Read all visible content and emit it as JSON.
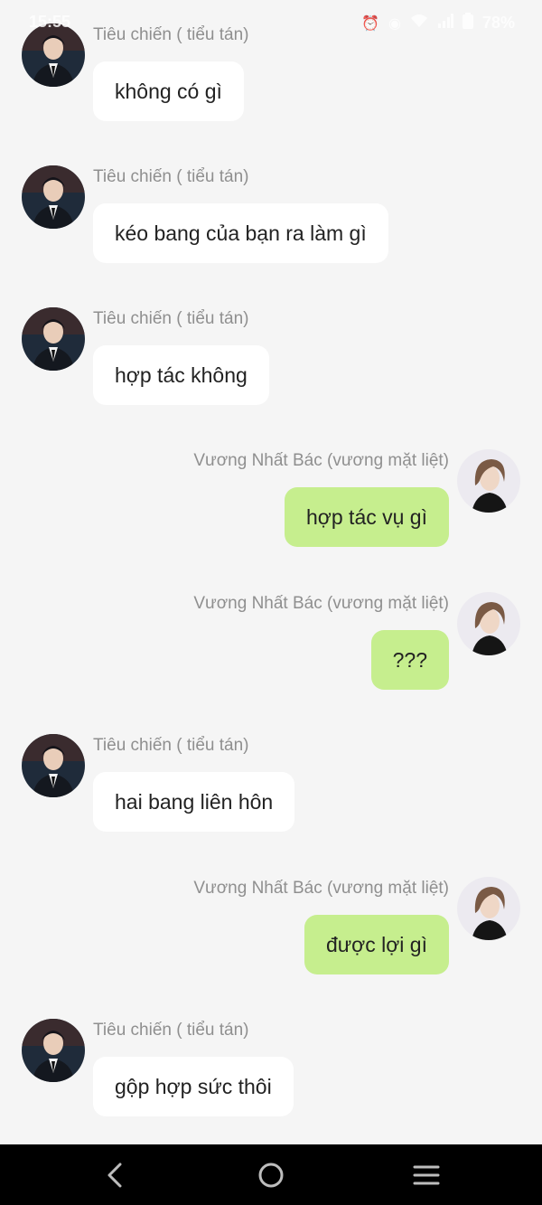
{
  "status_bar": {
    "time": "15:55",
    "battery": "78%"
  },
  "colors": {
    "background": "#f5f5f5",
    "incoming_bubble": "#ffffff",
    "outgoing_bubble": "#c6ee8e",
    "sender_name": "#8f8f8f"
  },
  "messages": [
    {
      "side": "left",
      "sender": "Tiêu chiến ( tiểu tán)",
      "text": "không có gì"
    },
    {
      "side": "left",
      "sender": "Tiêu chiến ( tiểu tán)",
      "text": "kéo bang của bạn ra làm gì"
    },
    {
      "side": "left",
      "sender": "Tiêu chiến ( tiểu tán)",
      "text": "hợp tác không"
    },
    {
      "side": "right",
      "sender": "Vương Nhất Bác (vương mặt liệt)",
      "text": "hợp tác vụ gì"
    },
    {
      "side": "right",
      "sender": "Vương Nhất Bác (vương mặt liệt)",
      "text": "???"
    },
    {
      "side": "left",
      "sender": "Tiêu chiến ( tiểu tán)",
      "text": "hai bang liên hôn"
    },
    {
      "side": "right",
      "sender": "Vương Nhất Bác (vương mặt liệt)",
      "text": "được lợi gì"
    },
    {
      "side": "left",
      "sender": "Tiêu chiến ( tiểu tán)",
      "text": "gộp hợp sức thôi"
    }
  ],
  "nav_bar": {
    "icons": [
      "back-icon",
      "home-icon",
      "recent-apps-icon"
    ]
  }
}
